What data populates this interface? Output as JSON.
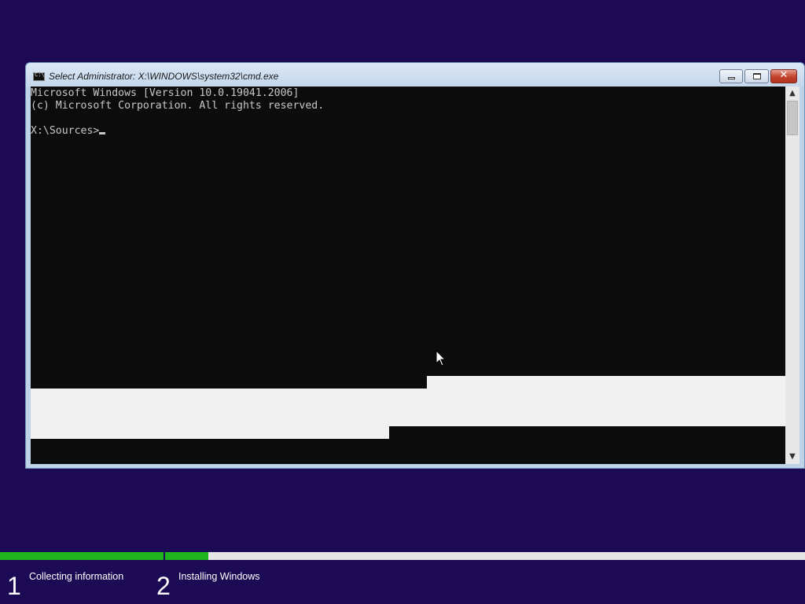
{
  "window": {
    "title": "Select Administrator: X:\\WINDOWS\\system32\\cmd.exe",
    "controls": {
      "minimize": "minimize",
      "maximize": "maximize",
      "close": "✕"
    }
  },
  "console": {
    "lines": [
      "Microsoft Windows [Version 10.0.19041.2006]",
      "(c) Microsoft Corporation. All rights reserved.",
      ""
    ],
    "prompt": "X:\\Sources>"
  },
  "scrollbar": {
    "up_arrow": "▲",
    "down_arrow": "▼"
  },
  "setup": {
    "steps": [
      {
        "number": "1",
        "label": "Collecting information",
        "progress": 1.0
      },
      {
        "number": "2",
        "label": "Installing Windows",
        "progress": 0.068
      }
    ]
  },
  "colors": {
    "desktop_background": "#1d0a55",
    "console_background": "#0c0c0c",
    "console_text": "#c8c8c8",
    "progress_fill": "#1fb31f",
    "progress_track": "#e6e6e6"
  }
}
